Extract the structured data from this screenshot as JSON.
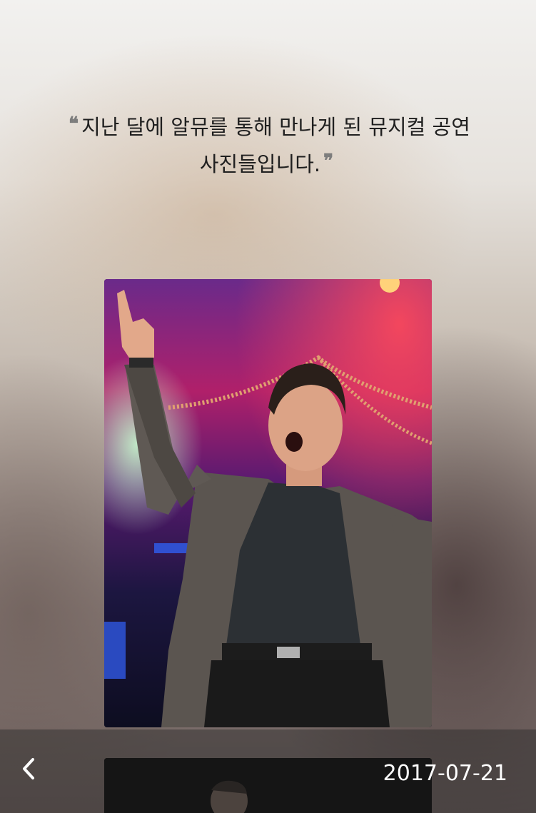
{
  "quote": {
    "line1": "지난 달에 알뮤를 통해 만나게 된 뮤지컬 공연",
    "line2": "사진들입니다.",
    "open_mark": "❝",
    "close_mark": "❞"
  },
  "photo": {
    "icon": "photo-performer-singing"
  },
  "footer": {
    "back_icon": "chevron-left-icon",
    "date": "2017-07-21"
  }
}
